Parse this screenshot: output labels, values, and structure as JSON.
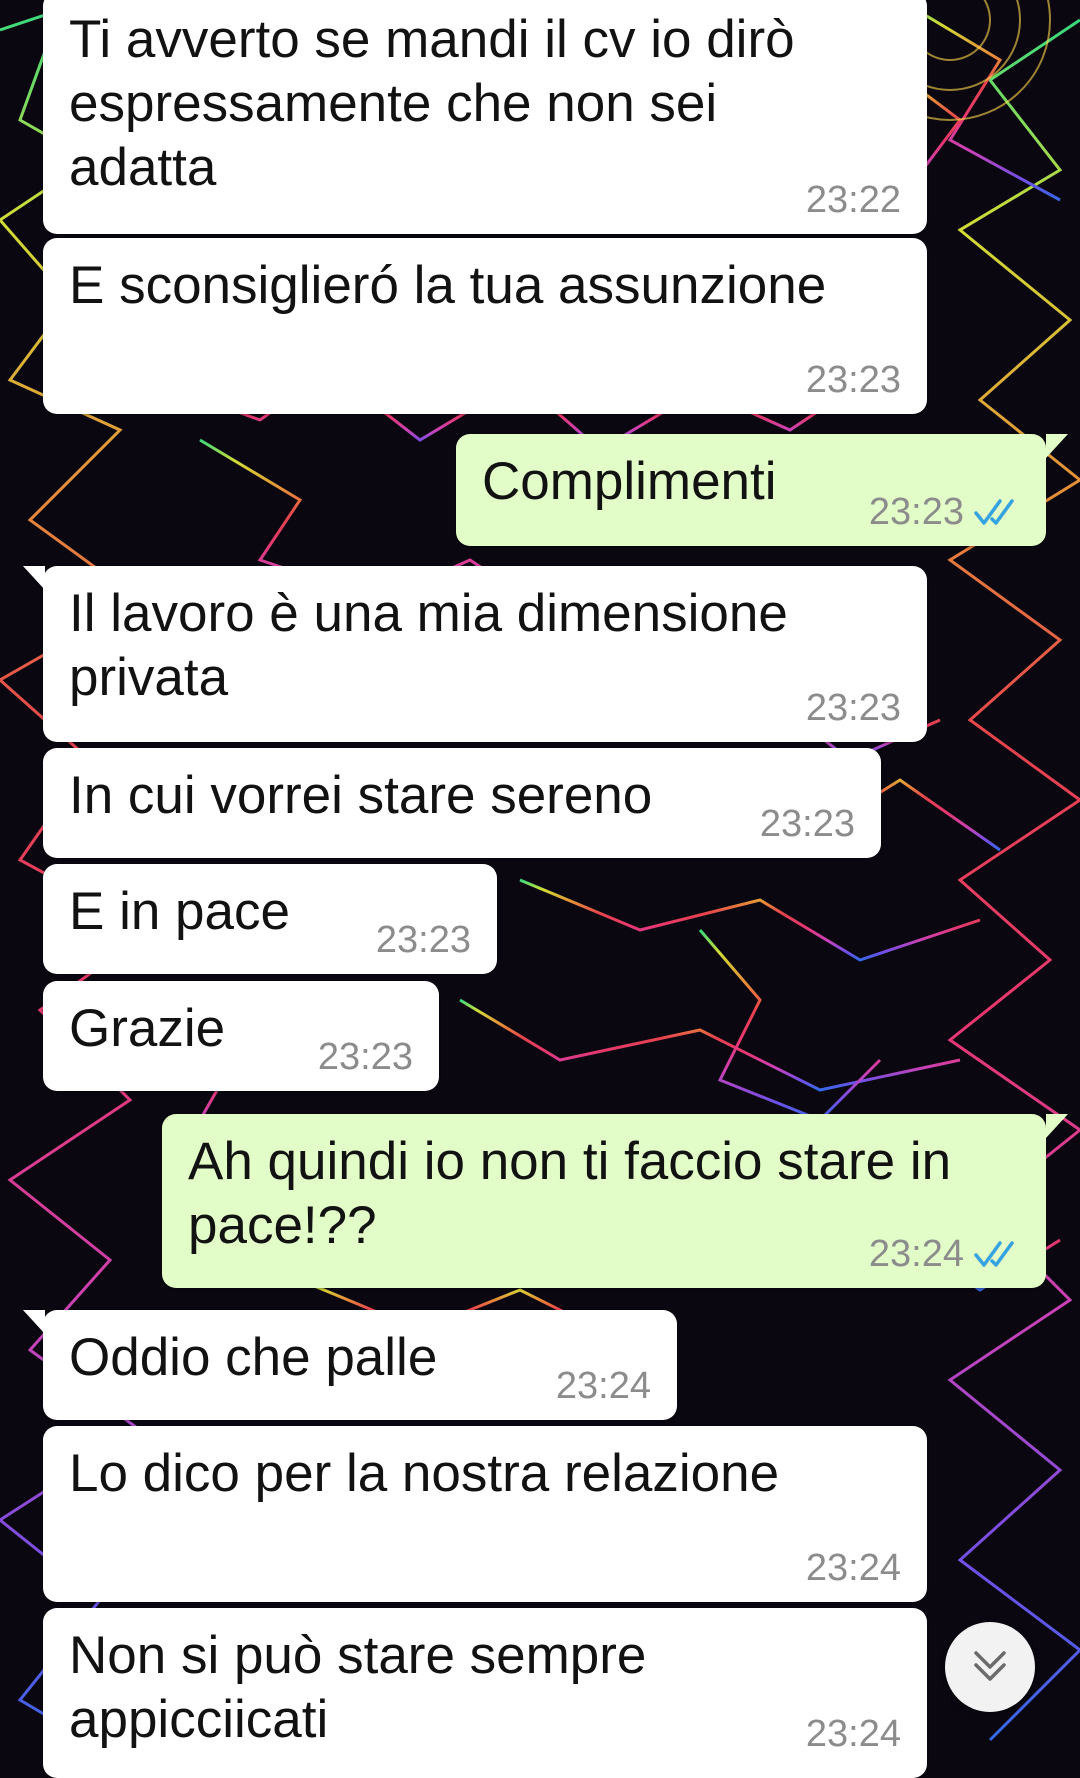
{
  "colors": {
    "incoming_bubble": "#ffffff",
    "outgoing_bubble": "#e3fdc8",
    "timestamp": "#8c8c8c",
    "read_ticks": "#34a3e0"
  },
  "messages": [
    {
      "dir": "in",
      "text": "Ti avverto se mandi il cv io dirò\nespressamente che non sei\nadatta",
      "time": "23:22"
    },
    {
      "dir": "in",
      "text": "E sconsiglieró la tua assunzione",
      "time": "23:23"
    },
    {
      "dir": "out",
      "text": "Complimenti",
      "time": "23:23",
      "status": "read"
    },
    {
      "dir": "in",
      "text": "Il lavoro è una mia dimensione\nprivata",
      "time": "23:23"
    },
    {
      "dir": "in",
      "text": "In cui vorrei stare sereno",
      "time": "23:23"
    },
    {
      "dir": "in",
      "text": "E in pace",
      "time": "23:23"
    },
    {
      "dir": "in",
      "text": "Grazie",
      "time": "23:23"
    },
    {
      "dir": "out",
      "text": "Ah quindi io non ti faccio stare in\npace!??",
      "time": "23:24",
      "status": "read"
    },
    {
      "dir": "in",
      "text": "Oddio che palle",
      "time": "23:24"
    },
    {
      "dir": "in",
      "text": "Lo dico per la nostra relazione",
      "time": "23:24"
    },
    {
      "dir": "in",
      "text": "Non si può stare sempre\nappicciicati",
      "time": "23:24"
    }
  ],
  "scroll_button": {
    "icon": "double-chevron-down-icon"
  }
}
